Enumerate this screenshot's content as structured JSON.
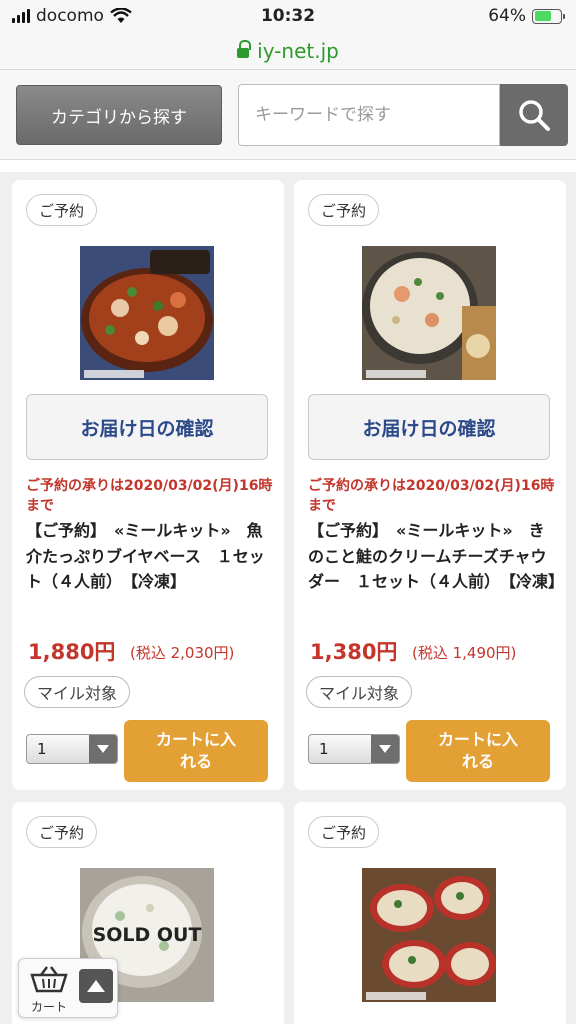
{
  "status_bar": {
    "carrier": "docomo",
    "time": "10:32",
    "battery": "64%"
  },
  "browser": {
    "url": "iy-net.jp"
  },
  "search": {
    "category_button": "カテゴリから探す",
    "keyword_placeholder": "キーワードで探す"
  },
  "products": [
    {
      "tag": "ご予約",
      "image_label": "",
      "date_button": "お届け日の確認",
      "deadline": "ご予約の承りは2020/03/02(月)16時まで",
      "title": "【ご予約】　«ミールキット»　魚介たっぷりブイヤベース　１セット（４人前）　【冷凍】",
      "price": "1,880円",
      "tax_in": "(税込 2,030円)",
      "mile": "マイル対象",
      "qty": "1",
      "cart_button": "カートに入れる"
    },
    {
      "tag": "ご予約",
      "image_label": "",
      "date_button": "お届け日の確認",
      "deadline": "ご予約の承りは2020/03/02(月)16時まで",
      "title": "【ご予約】　«ミールキット»　きのこと鮭のクリームチーズチャウダー　１セット（４人前）　【冷凍】",
      "price": "1,380円",
      "tax_in": "(税込 1,490円)",
      "mile": "マイル対象",
      "qty": "1",
      "cart_button": "カートに入れる"
    },
    {
      "tag": "ご予約",
      "image_label": "SOLD OUT"
    },
    {
      "tag": "ご予約",
      "image_label": ""
    }
  ],
  "floating_cart": {
    "label": "カート"
  },
  "colors": {
    "accent_red": "#c4352b",
    "cart_orange": "#e3a035",
    "link_blue": "#2c4a8a",
    "url_green": "#2e9a2e"
  }
}
